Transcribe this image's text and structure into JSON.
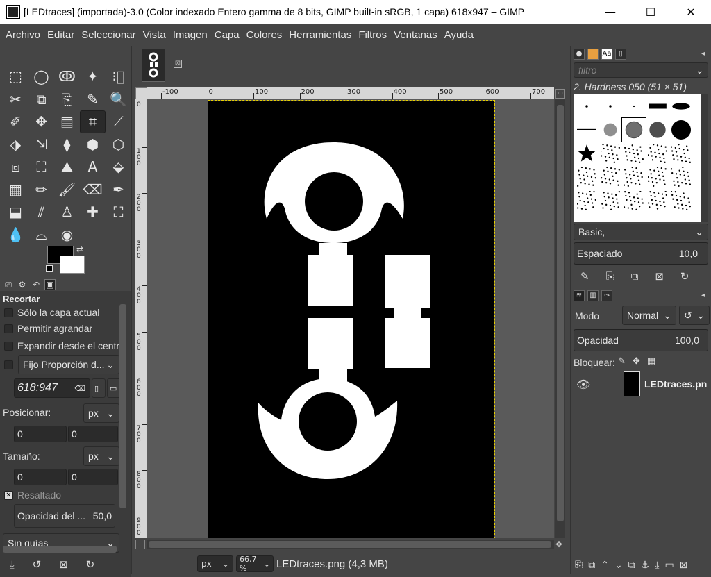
{
  "window": {
    "title": "[LEDtraces] (importada)-3.0 (Color indexado Entero gamma de 8 bits, GIMP built-in sRGB, 1 capa) 618x947 – GIMP",
    "minimize": "—",
    "maximize": "☐",
    "close": "✕"
  },
  "menu": [
    "Archivo",
    "Editar",
    "Seleccionar",
    "Vista",
    "Imagen",
    "Capa",
    "Colores",
    "Herramientas",
    "Filtros",
    "Ventanas",
    "Ayuda"
  ],
  "tools": [
    "⬚",
    "◯",
    "ↂ",
    "✦",
    "⁝⃞",
    "✂",
    "⧉",
    "⎘",
    "✎",
    "🔍",
    "✐",
    "✥",
    "▤",
    "⌗",
    "⟋",
    "⬗",
    "⇲",
    "⧫",
    "⬢",
    "⬡",
    "⧈",
    "⛶",
    "⛰",
    "A",
    "⬙",
    "▦",
    "✏",
    "🖌",
    "⌫",
    "✒",
    "⬓",
    "⫽",
    "♙",
    "✚",
    "⛶",
    "💧",
    "⌓",
    "◉"
  ],
  "active_tool_index": 13,
  "tool_options": {
    "title": "Recortar",
    "current_layer_only": "Sólo la capa actual",
    "allow_growing": "Permitir agrandar",
    "expand_from_center": "Expandir desde el centro",
    "fixed_combo": "Fijo Proporción d...",
    "ratio_value": "618:947",
    "position_label": "Posicionar:",
    "position_unit": "px",
    "pos_x": "0",
    "pos_y": "0",
    "size_label": "Tamaño:",
    "size_unit": "px",
    "size_w": "0",
    "size_h": "0",
    "highlight": "Resaltado",
    "highlight_opacity_label": "Opacidad del ...",
    "highlight_opacity_value": "50,0",
    "guides": "Sin guías"
  },
  "canvas": {
    "ruler_h": [
      "-100",
      "0",
      "100",
      "200",
      "300",
      "400",
      "500",
      "600",
      "700"
    ],
    "ruler_v": [
      "0",
      "100",
      "200",
      "300",
      "400",
      "500",
      "600",
      "700",
      "800",
      "900"
    ],
    "unit": "px",
    "zoom": "66,7 %",
    "status": "LEDtraces.png (4,3 MB)",
    "tab_close": "⊠"
  },
  "brushes": {
    "filter_placeholder": "filtro",
    "selected_brush": "2. Hardness 050 (51 × 51)",
    "preset": "Basic,",
    "spacing_label": "Espaciado",
    "spacing_value": "10,0"
  },
  "layers": {
    "mode_label": "Modo",
    "mode_value": "Normal",
    "opacity_label": "Opacidad",
    "opacity_value": "100,0",
    "lock_label": "Bloquear:",
    "layer_name": "LEDtraces.pn"
  }
}
